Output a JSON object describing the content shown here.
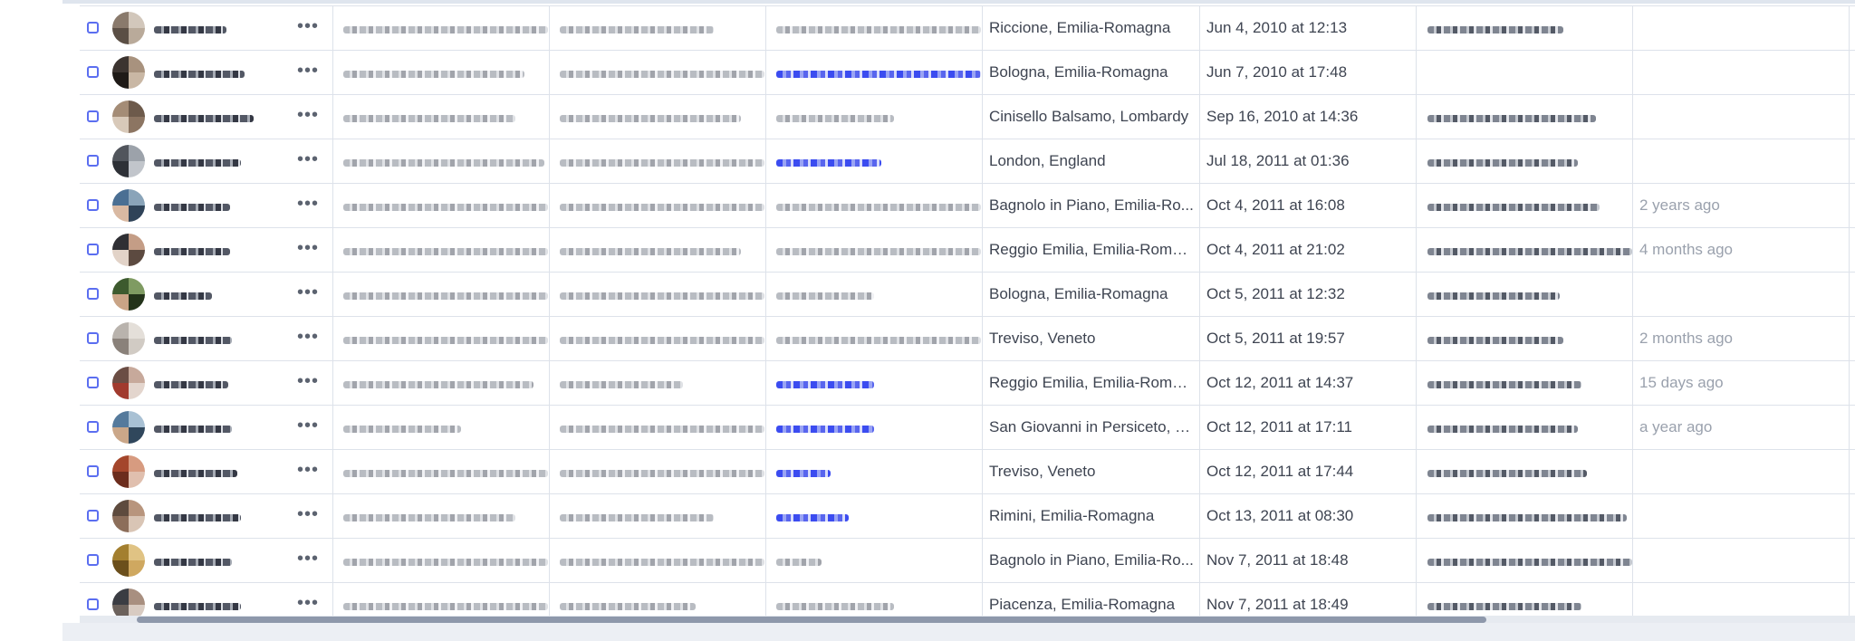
{
  "table": {
    "rows": [
      {
        "location": "Riccione, Emilia-Romagna",
        "created": "Jun 4, 2010 at 12:13",
        "last_contact": ""
      },
      {
        "location": "Bologna, Emilia-Romagna",
        "created": "Jun 7, 2010 at 17:48",
        "last_contact": ""
      },
      {
        "location": "Cinisello Balsamo, Lombardy",
        "created": "Sep 16, 2010 at 14:36",
        "last_contact": ""
      },
      {
        "location": "London, England",
        "created": "Jul 18, 2011 at 01:36",
        "last_contact": ""
      },
      {
        "location": "Bagnolo in Piano, Emilia-Ro...",
        "created": "Oct 4, 2011 at 16:08",
        "last_contact": "2 years ago"
      },
      {
        "location": "Reggio Emilia, Emilia-Romag...",
        "created": "Oct 4, 2011 at 21:02",
        "last_contact": "4 months ago"
      },
      {
        "location": "Bologna, Emilia-Romagna",
        "created": "Oct 5, 2011 at 12:32",
        "last_contact": ""
      },
      {
        "location": "Treviso, Veneto",
        "created": "Oct 5, 2011 at 19:57",
        "last_contact": "2 months ago"
      },
      {
        "location": "Reggio Emilia, Emilia-Romag...",
        "created": "Oct 12, 2011 at 14:37",
        "last_contact": "15 days ago"
      },
      {
        "location": "San Giovanni in Persiceto, E...",
        "created": "Oct 12, 2011 at 17:11",
        "last_contact": "a year ago"
      },
      {
        "location": "Treviso, Veneto",
        "created": "Oct 12, 2011 at 17:44",
        "last_contact": ""
      },
      {
        "location": "Rimini, Emilia-Romagna",
        "created": "Oct 13, 2011 at 08:30",
        "last_contact": ""
      },
      {
        "location": "Bagnolo in Piano, Emilia-Ro...",
        "created": "Nov 7, 2011 at 18:48",
        "last_contact": ""
      },
      {
        "location": "Piacenza, Emilia-Romagna",
        "created": "Nov 7, 2011 at 18:49",
        "last_contact": ""
      }
    ],
    "row_action_label": "•••"
  },
  "colors": {
    "accent": "#5b6ef0",
    "link": "#3b4cf0",
    "text": "#3e4451",
    "muted": "#9aa1ad",
    "grid": "#dde2ea",
    "background": "#eceff4"
  },
  "icons": {
    "checkbox": "checkbox-icon",
    "avatar": "avatar",
    "more": "more-options-icon"
  }
}
